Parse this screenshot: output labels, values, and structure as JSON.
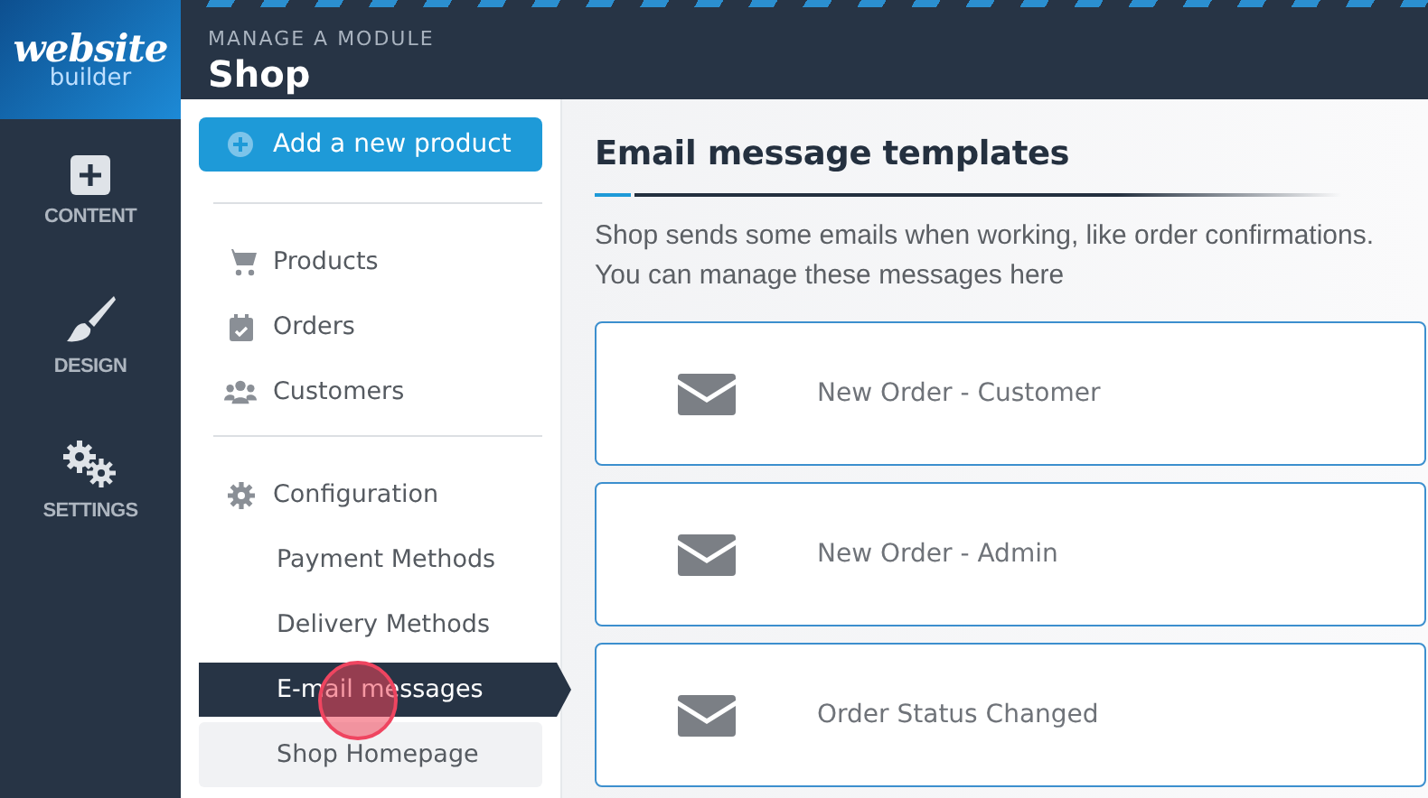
{
  "logo": {
    "line_1": "website",
    "line_2": "builder"
  },
  "nav": [
    {
      "label": "CONTENT",
      "kind": "plus"
    },
    {
      "label": "DESIGN",
      "kind": "brush"
    },
    {
      "label": "SETTINGS",
      "kind": "gears"
    }
  ],
  "header": {
    "overline": "MANAGE A MODULE",
    "title": "Shop"
  },
  "add_button": {
    "label": "Add a new product"
  },
  "menu_groups": [
    [
      {
        "label": "Products",
        "kind": "cart",
        "selected": false,
        "hovered": false
      },
      {
        "label": "Orders",
        "kind": "calendar",
        "selected": false,
        "hovered": false
      },
      {
        "label": "Customers",
        "kind": "users",
        "selected": false,
        "hovered": false
      }
    ],
    [
      {
        "label": "Configuration",
        "kind": "gear",
        "selected": false,
        "hovered": false
      },
      {
        "label": "Payment Methods",
        "selected": false,
        "hovered": false
      },
      {
        "label": "Delivery Methods",
        "selected": false,
        "hovered": false
      },
      {
        "label": "E-mail messages",
        "selected": true,
        "hovered": false
      },
      {
        "label": "Shop Homepage",
        "selected": false,
        "hovered": true
      }
    ]
  ],
  "main": {
    "title": "Email message templates",
    "description": "Shop sends some emails when working, like order confirmations. You can manage these messages here",
    "templates": [
      {
        "label": "New Order - Customer"
      },
      {
        "label": "New Order - Admin"
      },
      {
        "label": "Order Status Changed"
      }
    ]
  }
}
